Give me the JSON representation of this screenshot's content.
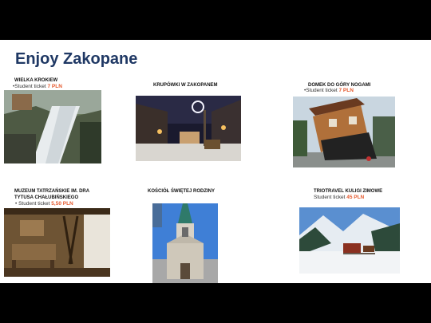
{
  "slide": {
    "title": "Enjoy Zakopane",
    "items": [
      {
        "name": "WIELKA KROKIEW",
        "ticket_prefix": "•Student ticket ",
        "ticket_price": "7 PLN",
        "image": "ski-jump-photo"
      },
      {
        "name": "KRUPÓWKI W ZAKOPANEM",
        "image": "krupowki-street-photo"
      },
      {
        "name": "DOMEK DO GÓRY NOGAMI",
        "ticket_prefix": "•Student ticket ",
        "ticket_price": "7 PLN",
        "image": "upside-down-house-photo"
      },
      {
        "name_line1": "MUZEUM TATRZAŃSKIE IM. DRA",
        "name_line2": "TYTUSA CHAŁUBIŃSKIEGO",
        "ticket_prefix": "• Student ticket ",
        "ticket_price": "5,50 PLN",
        "image": "museum-interior-photo"
      },
      {
        "name": "KOŚCIÓŁ ŚWIĘTEJ RODZINY",
        "image": "church-photo"
      },
      {
        "name": "TRIOTRAVEL KULIGI ZIMOWE",
        "ticket_prefix": "Student ticket ",
        "ticket_price": "45 PLN",
        "image": "sleigh-ride-photo"
      }
    ]
  },
  "colors": {
    "title": "#1f3864",
    "price": "#e5582c",
    "frame": "#000000"
  }
}
